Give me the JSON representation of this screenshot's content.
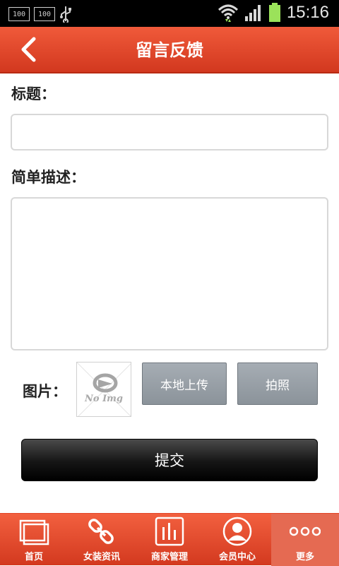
{
  "status_bar": {
    "badges": [
      "100",
      "100"
    ],
    "time": "15:16"
  },
  "header": {
    "title": "留言反馈"
  },
  "form": {
    "title_label": "标题：",
    "title_value": "",
    "desc_label": "简单描述：",
    "desc_value": "",
    "image_label": "图片：",
    "placeholder_image_text": "No Img",
    "upload_local_label": "本地上传",
    "take_photo_label": "拍照",
    "submit_label": "提交"
  },
  "bottom_nav": {
    "items": [
      {
        "label": "首页",
        "icon": "home-icon"
      },
      {
        "label": "女装资讯",
        "icon": "link-icon"
      },
      {
        "label": "商家管理",
        "icon": "chart-icon"
      },
      {
        "label": "会员中心",
        "icon": "user-icon"
      },
      {
        "label": "更多",
        "icon": "more-icon"
      }
    ],
    "active_index": 4
  },
  "colors": {
    "header_red": "#e04a2c",
    "submit_black": "#111111",
    "button_gray": "#9aa1a8"
  }
}
